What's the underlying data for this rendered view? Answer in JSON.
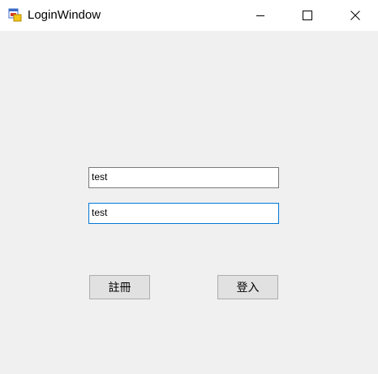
{
  "window": {
    "title": "LoginWindow",
    "app_icon": "form-app-icon",
    "controls": {
      "minimize_icon": "minimize-icon",
      "maximize_icon": "maximize-icon",
      "close_icon": "close-icon"
    }
  },
  "form": {
    "username_value": "test",
    "password_value": "test",
    "register_label": "註冊",
    "login_label": "登入"
  },
  "colors": {
    "background": "#f0f0f0",
    "focus_border": "#0078d7",
    "button_face": "#e1e1e1"
  }
}
